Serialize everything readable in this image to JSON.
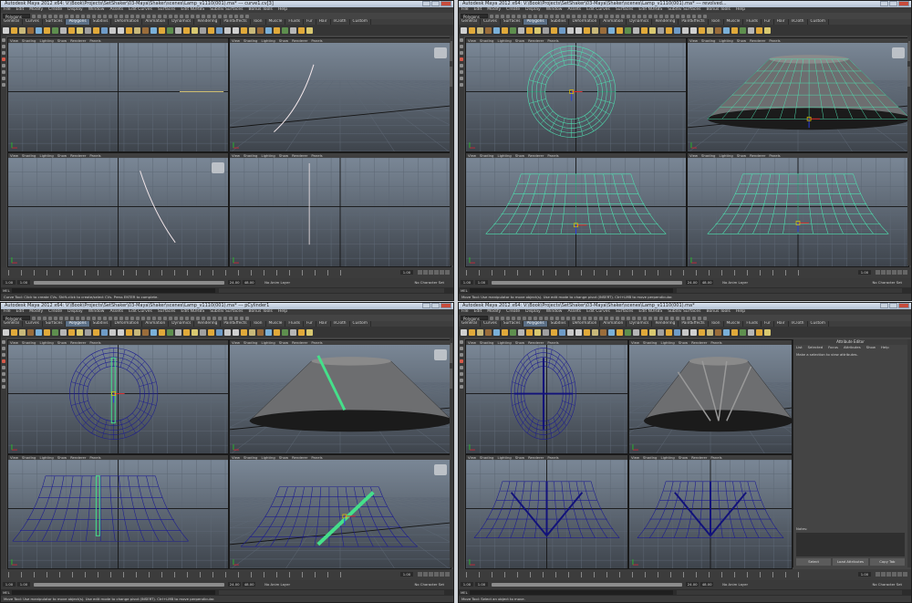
{
  "windows": [
    {
      "id": "w1",
      "title": "Autodesk Maya 2012 x64: V:\\Book\\Projects\\SetShaker\\03-Maya\\Shaker\\scenes\\Lamp_v1110(001).ma* --- curve1.cv[3]",
      "mode": "Polygons",
      "helpline": "Curve Tool: Click to create CVs. Shift-click to create/select CVs. Press ENTER to complete.",
      "start": "1.00",
      "end": "24.00",
      "range_start": "1.00",
      "range_end": "24.00",
      "anim_end": "48.00",
      "current_frame": "1.00",
      "anim_layer": "No Anim Layer",
      "char_set": "No Character Set",
      "active_shelf": 3,
      "panes": [
        "curve-top",
        "curve-persp",
        "curve-front",
        "curve-side"
      ]
    },
    {
      "id": "w2",
      "title": "Autodesk Maya 2012 x64: V:\\Book\\Projects\\SetShaker\\03-Maya\\Shaker\\scenes\\Lamp_v1110(001).ma* --- revolved...",
      "mode": "Polygons",
      "helpline": "Move Tool: Use manipulator to move object(s). Use edit mode to change pivot (INSERT). Ctrl+LMB to move perpendicular.",
      "start": "1.00",
      "end": "24.00",
      "range_start": "1.00",
      "range_end": "24.00",
      "anim_end": "48.00",
      "current_frame": "1.00",
      "anim_layer": "No Anim Layer",
      "char_set": "No Character Set",
      "active_shelf": 3,
      "panes": [
        "ring-top",
        "shade-persp-green",
        "side-green",
        "front-green"
      ]
    },
    {
      "id": "w3",
      "title": "Autodesk Maya 2012 x64: V:\\Book\\Projects\\SetShaker\\03-Maya\\Shaker\\scenes\\Lamp_v1110(001).ma* --- pCylinder1",
      "mode": "Polygons",
      "helpline": "Move Tool: Use manipulator to move object(s). Use edit mode to change pivot (INSERT). Ctrl+LMB to move perpendicular.",
      "start": "1.00",
      "end": "24.00",
      "range_start": "1.00",
      "range_end": "24.00",
      "anim_end": "48.00",
      "current_frame": "1.00",
      "anim_layer": "No Anim Layer",
      "char_set": "No Character Set",
      "active_shelf": 3,
      "panes": [
        "ring-blue",
        "shade-persp-cyl",
        "side-blue-cyl",
        "persp-blue-diag"
      ]
    },
    {
      "id": "w4",
      "title": "Autodesk Maya 2012 x64: V:\\Book\\Projects\\SetShaker\\03-Maya\\Shaker\\scenes\\Lamp_v1110(001).ma*",
      "mode": "Polygons",
      "helpline": "Move Tool: Select an object to move.",
      "start": "1.00",
      "end": "24.00",
      "range_start": "1.00",
      "range_end": "24.00",
      "anim_end": "48.00",
      "current_frame": "1.00",
      "anim_layer": "No Anim Layer",
      "char_set": "No Character Set",
      "active_shelf": 3,
      "panes": [
        "ring-blue-cross",
        "shade-inside",
        "side-blue-arrows",
        "front-blue-arrows"
      ],
      "attribute_editor": {
        "title": "Attribute Editor",
        "menus": [
          "List",
          "Selected",
          "Focus",
          "Attributes",
          "Show",
          "Help"
        ],
        "message": "Make a selection to view attributes.",
        "notes_label": "Notes:",
        "buttons": [
          "Select",
          "Load Attributes",
          "Copy Tab"
        ]
      }
    }
  ],
  "menubar": [
    "File",
    "Edit",
    "Modify",
    "Create",
    "Display",
    "Window",
    "Assets",
    "Edit Curves",
    "Surfaces",
    "Edit NURBS",
    "Subdiv Surfaces",
    "Bonus Tools",
    "Help"
  ],
  "shelf_tabs": [
    "General",
    "Curves",
    "Surfaces",
    "Polygons",
    "Subdivs",
    "Deformation",
    "Animation",
    "Dynamics",
    "Rendering",
    "PaintEffects",
    "Toon",
    "Muscle",
    "Fluids",
    "Fur",
    "Hair",
    "nCloth",
    "Custom"
  ],
  "panel_menu": [
    "View",
    "Shading",
    "Lighting",
    "Show",
    "Renderer",
    "Panels"
  ],
  "mel_label": "MEL",
  "colors": {
    "grid": "#5d6875",
    "grid_axis": "#151515",
    "green_wire": "#4ee0b0",
    "blue_wire": "#1d1d8f",
    "shelf_accent": "#e0a93a"
  }
}
